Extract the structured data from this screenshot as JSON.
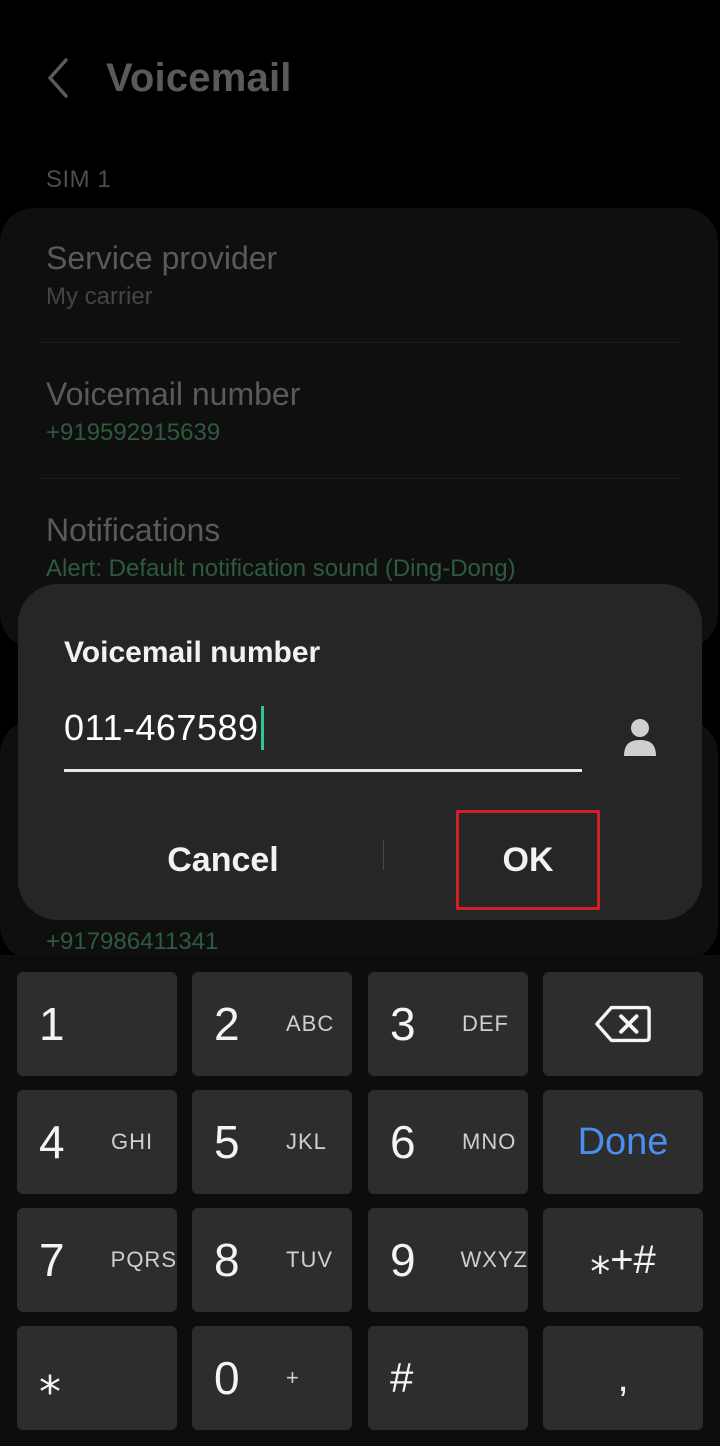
{
  "header": {
    "title": "Voicemail"
  },
  "section": {
    "label": "SIM 1"
  },
  "settings": [
    {
      "title": "Service provider",
      "subtitle": "My carrier"
    },
    {
      "title": "Voicemail number",
      "subtitle": "+919592915639"
    },
    {
      "title": "Notifications",
      "subtitle": "Alert: Default notification sound (Ding-Dong)"
    }
  ],
  "peek_number": "+917986411341",
  "dialog": {
    "title": "Voicemail number",
    "input_value": "011-467589",
    "cancel_label": "Cancel",
    "ok_label": "OK"
  },
  "keyboard": {
    "keys": [
      {
        "num": "1",
        "letters": ""
      },
      {
        "num": "2",
        "letters": "ABC"
      },
      {
        "num": "3",
        "letters": "DEF"
      },
      {
        "num": "4",
        "letters": "GHI"
      },
      {
        "num": "5",
        "letters": "JKL"
      },
      {
        "num": "6",
        "letters": "MNO"
      },
      {
        "num": "7",
        "letters": "PQRS"
      },
      {
        "num": "8",
        "letters": "TUV"
      },
      {
        "num": "9",
        "letters": "WXYZ"
      },
      {
        "num": "0",
        "letters": "+"
      }
    ],
    "done_label": "Done",
    "symbols_label": "⁎+#",
    "star_label": "⁎",
    "hash_label": "#",
    "comma_label": ","
  },
  "colors": {
    "accent_blue": "#4a8ff0",
    "caret_green": "#2fc78a",
    "highlight_red": "#d21e26"
  },
  "icons": {
    "back": "chevron-left-icon",
    "contact": "person-icon",
    "backspace": "backspace-icon"
  }
}
